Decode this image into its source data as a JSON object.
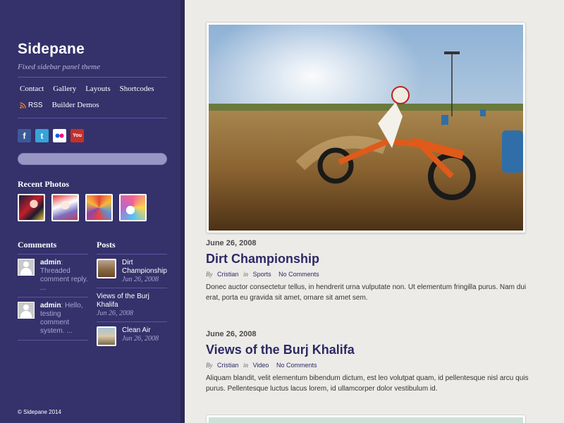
{
  "site": {
    "title": "Sidepane",
    "tagline": "Fixed sidebar panel theme",
    "copyright": "© Sidepane 2014"
  },
  "nav": {
    "items": [
      "Contact",
      "Gallery",
      "Layouts",
      "Shortcodes"
    ],
    "rss_label": "RSS",
    "builder": "Builder Demos"
  },
  "social": [
    {
      "name": "facebook-icon",
      "glyph": "f"
    },
    {
      "name": "twitter-icon",
      "glyph": "t"
    },
    {
      "name": "flickr-icon",
      "glyph": ""
    },
    {
      "name": "youtube-icon",
      "glyph": "You"
    }
  ],
  "sidebar": {
    "recent_photos_title": "Recent Photos",
    "comments_title": "Comments",
    "posts_title": "Posts",
    "comments": [
      {
        "author": "admin",
        "text": ": Threaded comment reply. ..."
      },
      {
        "author": "admin",
        "text": ": Hello, testing comment system. ..."
      }
    ],
    "posts": [
      {
        "title": "Dirt Championship",
        "date": "Jun 26, 2008"
      },
      {
        "title": "Views of the Burj Khalifa",
        "date": "Jun 26, 2008"
      },
      {
        "title": "Clean Air",
        "date": "Jun 26, 2008"
      }
    ]
  },
  "posts": [
    {
      "date": "June 26, 2008",
      "title": "Dirt Championship",
      "by": "By",
      "author": "Cristian",
      "in": "in",
      "category": "Sports",
      "comments": "No Comments",
      "excerpt": "Donec auctor consectetur tellus, in hendrerit urna vulputate non. Ut elementum fringilla purus. Nam dui erat, porta eu gravida sit amet, ornare sit amet sem."
    },
    {
      "date": "June 26, 2008",
      "title": "Views of the Burj Khalifa",
      "by": "By",
      "author": "Cristian",
      "in": "in",
      "category": "Video",
      "comments": "No Comments",
      "excerpt": "Aliquam blandit, velit elementum bibendum dictum, est leo volutpat quam, id pellentesque nisl arcu quis purus. Pellentesque luctus lacus lorem, id ullamcorper dolor vestibulum id."
    }
  ],
  "colors": {
    "sidebar_bg": "#35316b",
    "accent": "#2d2966",
    "page_bg": "#ecebe7"
  }
}
